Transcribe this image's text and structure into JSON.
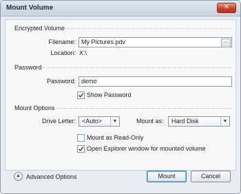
{
  "window": {
    "title": "Mount Volume",
    "close_glyph": "✕"
  },
  "encrypted_volume": {
    "section_title": "Encrypted Volume",
    "filename_label": "Filename:",
    "filename_value": "My Pictures.pdv",
    "browse_glyph": "…",
    "location_label": "Location:",
    "location_value": "X:\\"
  },
  "password": {
    "section_title": "Password",
    "password_label": "Password:",
    "password_value": "demo",
    "show_password_label": "Show Password",
    "show_password_checked": true
  },
  "mount_options": {
    "section_title": "Mount Options",
    "drive_letter_label": "Drive Letter:",
    "drive_letter_value": "<Auto>",
    "mount_as_label": "Mount as:",
    "mount_as_value": "Hard Disk",
    "read_only_label": "Mount as Read-Only",
    "read_only_checked": false,
    "open_explorer_label": "Open Explorer window for mounted volume",
    "open_explorer_checked": true
  },
  "footer": {
    "advanced_label": "Advanced Options",
    "mount_button": "Mount",
    "cancel_button": "Cancel"
  },
  "icons": {
    "close": "close-icon",
    "browse": "browse-icon",
    "check": "checkmark-icon",
    "dropdown": "chevron-down-icon",
    "advanced": "chevron-up-circle-icon"
  }
}
